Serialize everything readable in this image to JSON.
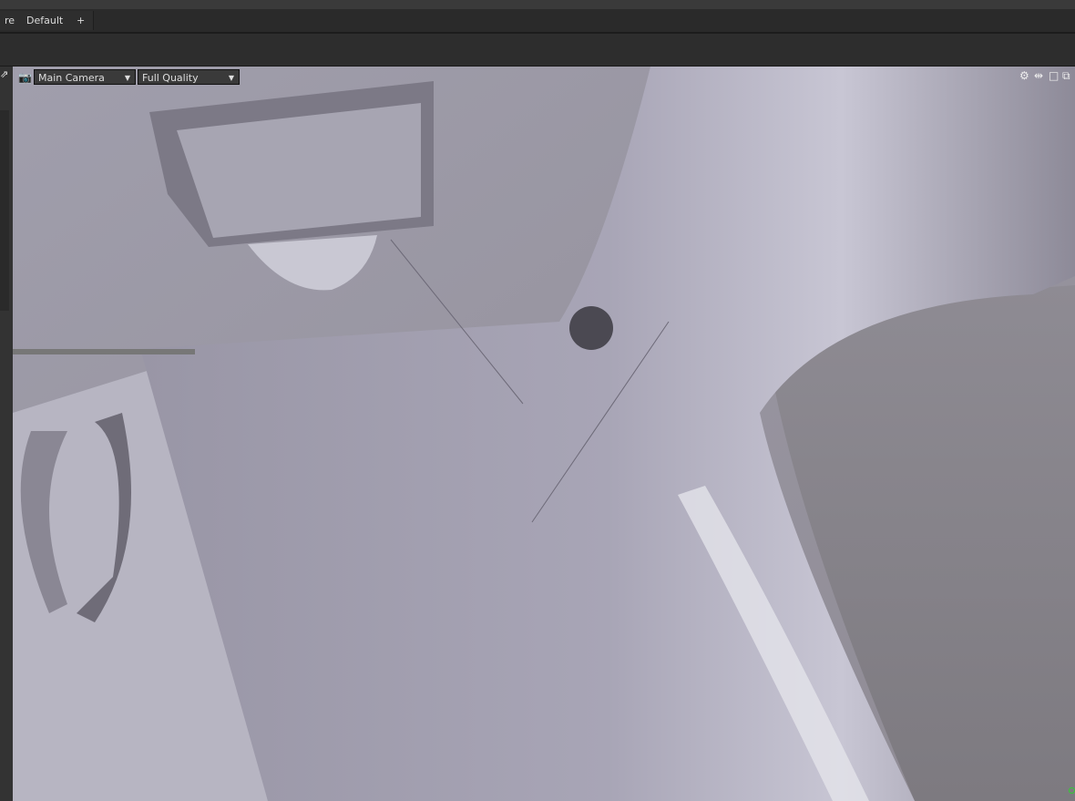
{
  "layout_tabs": [
    {
      "label": "re"
    },
    {
      "label": "Default"
    },
    {
      "label": "+"
    }
  ],
  "viewport": {
    "camera_select": "Main Camera",
    "quality_select": "Full Quality",
    "icons": [
      "camera-icon",
      "gear-icon",
      "move-icon",
      "maximize-icon",
      "popout-icon"
    ]
  }
}
